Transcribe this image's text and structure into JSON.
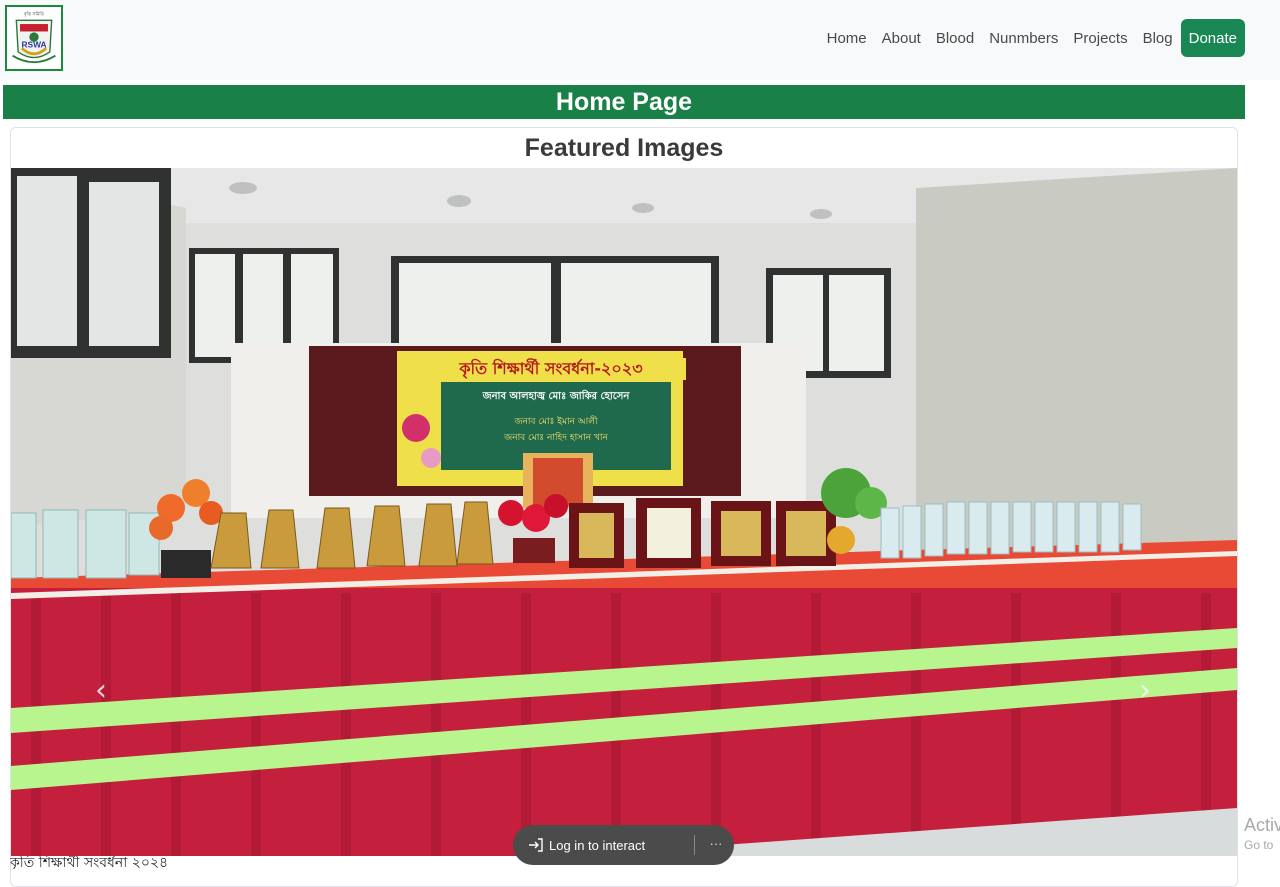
{
  "navbar": {
    "logo_text": "RSWA",
    "logo_top_text": "বৃত্তি সমিতি",
    "links": [
      "Home",
      "About",
      "Blood",
      "Nunmbers",
      "Projects",
      "Blog"
    ],
    "donate_label": "Donate"
  },
  "page_title": "Home Page",
  "featured": {
    "title": "Featured Images",
    "banner_title": "কৃতি শিক্ষার্থী সংবর্ধনা-২০২৩",
    "banner_line1": "জনাব আলহাজ্ব মোঃ জাকির হোসেন",
    "banner_line2": "জনাব মোঃ ইমান আলী",
    "banner_line3": "জনাব মোঃ নাহিদ হাসান খান",
    "prev_icon": "chevron-left-icon",
    "next_icon": "chevron-right-icon",
    "caption": "কৃতি শিক্ষার্থী সংবর্ধনা  ২০২৪"
  },
  "overlay": {
    "login_label": "Log in to interact",
    "more_label": "···"
  },
  "watermark": {
    "line1": "Activ",
    "line2": "Go to"
  },
  "colors": {
    "brand_green": "#198048",
    "donate_green": "#198754"
  }
}
